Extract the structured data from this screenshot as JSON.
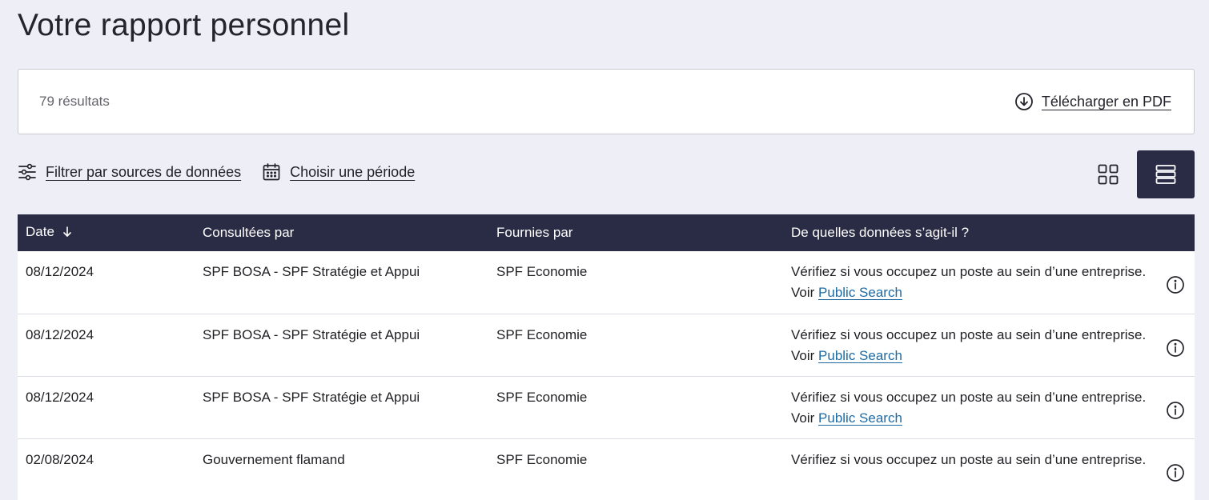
{
  "page": {
    "title": "Votre rapport personnel"
  },
  "results": {
    "count_label": "79 résultats",
    "download_label": "Télécharger en PDF",
    "download_icon": "download-circle-icon"
  },
  "filters": {
    "source_label": "Filtrer par sources de données",
    "source_icon": "sliders-icon",
    "period_label": "Choisir une période",
    "period_icon": "calendar-icon"
  },
  "view_toggle": {
    "grid_icon": "grid-view-icon",
    "list_icon": "list-view-icon",
    "active": "list"
  },
  "table": {
    "headers": {
      "date": "Date",
      "consulted_by": "Consultées par",
      "provided_by": "Fournies par",
      "which_data": "De quelles données s’agit-il ?"
    },
    "sort_icon": "arrow-down-icon",
    "rows": [
      {
        "date": "08/12/2024",
        "consulted_by": "SPF BOSA - SPF Stratégie et Appui",
        "provided_by": "SPF Economie",
        "description": "Vérifiez si vous occupez un poste au sein d’une entreprise.",
        "see_prefix": "Voir ",
        "link": "Public Search"
      },
      {
        "date": "08/12/2024",
        "consulted_by": "SPF BOSA - SPF Stratégie et Appui",
        "provided_by": "SPF Economie",
        "description": "Vérifiez si vous occupez un poste au sein d’une entreprise.",
        "see_prefix": "Voir ",
        "link": "Public Search"
      },
      {
        "date": "08/12/2024",
        "consulted_by": "SPF BOSA - SPF Stratégie et Appui",
        "provided_by": "SPF Economie",
        "description": "Vérifiez si vous occupez un poste au sein d’une entreprise.",
        "see_prefix": "Voir ",
        "link": "Public Search"
      },
      {
        "date": "02/08/2024",
        "consulted_by": "Gouvernement flamand",
        "provided_by": "SPF Economie",
        "description": "Vérifiez si vous occupez un poste au sein d’une entreprise.",
        "see_prefix": "",
        "link": ""
      }
    ]
  },
  "colors": {
    "background": "#eeeef6",
    "header_dark": "#292c44",
    "link": "#1d6aa3"
  }
}
